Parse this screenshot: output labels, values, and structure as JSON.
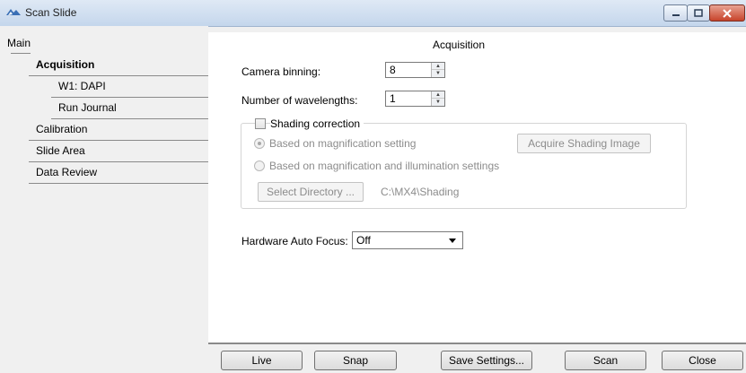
{
  "window": {
    "title": "Scan Slide",
    "controls": [
      "minimize",
      "maximize",
      "close"
    ]
  },
  "nav": {
    "main": "Main",
    "items": [
      {
        "label": "Acquisition",
        "bold": true
      },
      {
        "label": "W1: DAPI"
      },
      {
        "label": "Run Journal"
      },
      {
        "label": "Calibration"
      },
      {
        "label": "Slide Area"
      },
      {
        "label": "Data Review"
      }
    ]
  },
  "acquisition": {
    "section_title": "Acquisition",
    "camera_binning_label": "Camera binning:",
    "camera_binning_value": "8",
    "num_wavelengths_label": "Number of wavelengths:",
    "num_wavelengths_value": "1",
    "shading": {
      "checkbox_label": "Shading correction",
      "checked": false,
      "option_magnification": "Based on magnification setting",
      "option_mag_illum": "Based on magnification and illumination settings",
      "acquire_button": "Acquire Shading Image",
      "select_dir_button": "Select Directory ...",
      "directory": "C:\\MX4\\Shading"
    },
    "autofocus_label": "Hardware Auto Focus:",
    "autofocus_value": "Off"
  },
  "buttons": {
    "live": "Live",
    "snap": "Snap",
    "save_settings": "Save Settings...",
    "scan": "Scan",
    "close": "Close"
  }
}
